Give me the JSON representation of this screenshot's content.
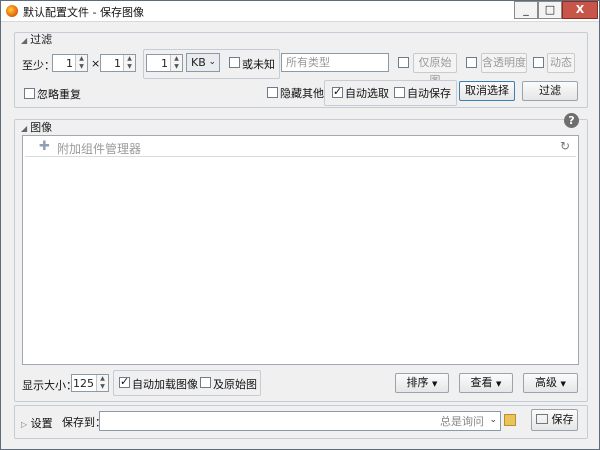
{
  "window": {
    "title": "默认配置文件 - 保存图像",
    "min_glyph": "_",
    "max_glyph": "□",
    "close_glyph": "X"
  },
  "filter": {
    "header": "过滤",
    "at_least_label": "至少：",
    "width_value": "1",
    "times": "×",
    "height_value": "1",
    "size_value": "1",
    "size_unit": "KB",
    "or_unknown": "或未知",
    "type_placeholder": "所有类型",
    "only_original": "仅原始图",
    "with_transparency": "含透明度",
    "animated": "动态",
    "ignore_duplicates": "忽略重复",
    "hide_others": "隐藏其他",
    "auto_select": "自动选取",
    "auto_save": "自动保存",
    "cancel_select": "取消选择",
    "filter_button": "过滤"
  },
  "images": {
    "header": "图像",
    "addon_manager": "附加组件管理器",
    "display_size_label": "显示大小：",
    "display_size_value": "125",
    "auto_load": "自动加载图像",
    "and_original": "及原始图",
    "sort": "排序",
    "view": "查看",
    "advanced": "高级"
  },
  "bottom": {
    "settings": "设置",
    "save_to_label": "保存到：",
    "always_ask": "总是询问",
    "save_button": "保存"
  }
}
